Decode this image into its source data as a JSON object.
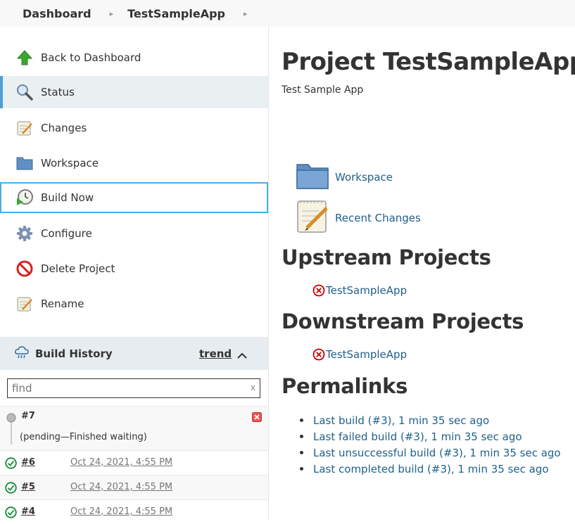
{
  "breadcrumb": {
    "items": [
      "Dashboard",
      "TestSampleApp"
    ]
  },
  "sidebar": {
    "tasks": [
      {
        "label": "Back to Dashboard",
        "icon": "up-arrow-icon"
      },
      {
        "label": "Status",
        "icon": "magnifier-icon"
      },
      {
        "label": "Changes",
        "icon": "notepad-icon"
      },
      {
        "label": "Workspace",
        "icon": "folder-icon"
      },
      {
        "label": "Build Now",
        "icon": "clock-play-icon"
      },
      {
        "label": "Configure",
        "icon": "gear-icon"
      },
      {
        "label": "Delete Project",
        "icon": "no-entry-icon"
      },
      {
        "label": "Rename",
        "icon": "notepad-icon"
      }
    ]
  },
  "build_history": {
    "title": "Build History",
    "trend_label": "trend",
    "find_placeholder": "find",
    "find_clear": "x",
    "pending": {
      "number": "#7",
      "status": "(pending—Finished waiting)"
    },
    "builds": [
      {
        "number": "#6",
        "date": "Oct 24, 2021, 4:55 PM"
      },
      {
        "number": "#5",
        "date": "Oct 24, 2021, 4:55 PM"
      },
      {
        "number": "#4",
        "date": "Oct 24, 2021, 4:55 PM"
      }
    ]
  },
  "main": {
    "title": "Project TestSampleApp",
    "description": "Test Sample App",
    "links": {
      "workspace": "Workspace",
      "recent_changes": "Recent Changes"
    },
    "upstream": {
      "heading": "Upstream Projects",
      "project": "TestSampleApp"
    },
    "downstream": {
      "heading": "Downstream Projects",
      "project": "TestSampleApp"
    },
    "permalinks": {
      "heading": "Permalinks",
      "items": [
        "Last build (#3), 1 min 35 sec ago",
        "Last failed build (#3), 1 min 35 sec ago",
        "Last unsuccessful build (#3), 1 min 35 sec ago",
        "Last completed build (#3), 1 min 35 sec ago"
      ]
    }
  },
  "colors": {
    "link": "#1f5f8b",
    "active_border": "#4b9fd5",
    "focus_border": "#4aaee8",
    "success": "#138a36",
    "error": "#cc0000"
  }
}
